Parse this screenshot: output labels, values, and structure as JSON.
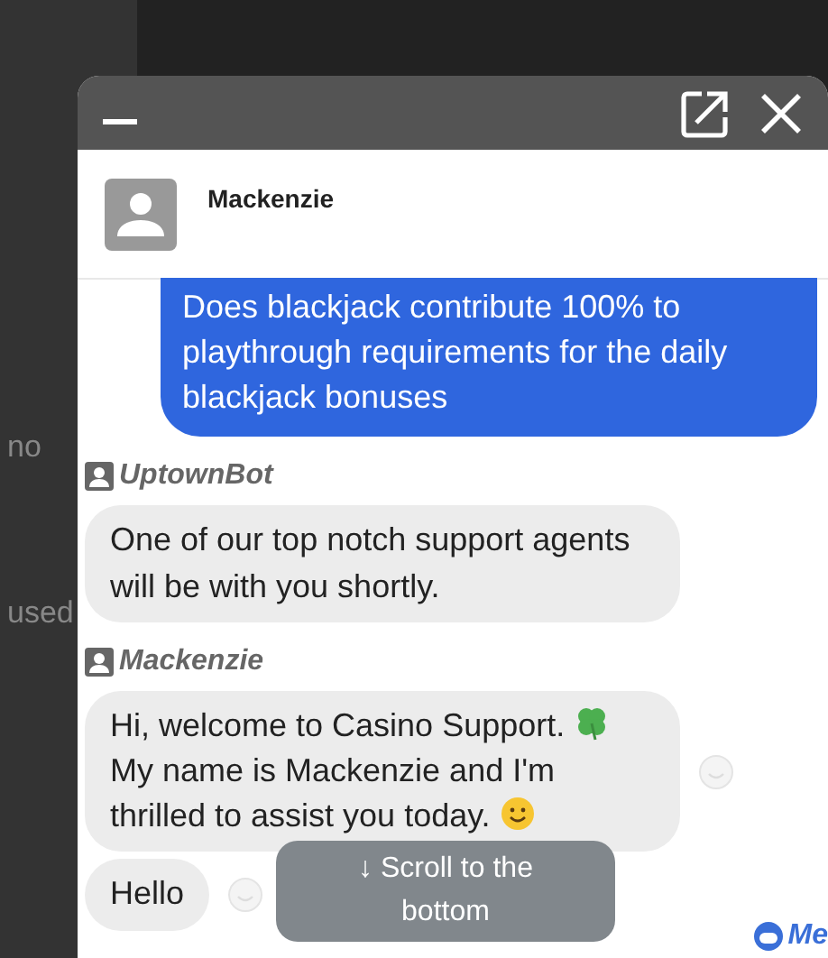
{
  "background_texts": [
    "no",
    "used"
  ],
  "chat_window": {
    "contact": {
      "name": "Mackenzie"
    },
    "messages": [
      {
        "kind": "outgoing",
        "parts": [
          {
            "kind": "text",
            "text": "Does blackjack contribute 100% to playthrough requirements for the daily blackjack bonuses"
          }
        ]
      },
      {
        "kind": "incoming",
        "sender": "UptownBot",
        "reaction": false,
        "parts": [
          {
            "kind": "text",
            "text": "One of our top notch support agents will be with you shortly."
          }
        ]
      },
      {
        "kind": "incoming",
        "sender": "Mackenzie",
        "reaction": true,
        "parts": [
          {
            "kind": "text",
            "text": "Hi, welcome to Casino Support. "
          },
          {
            "kind": "clover"
          },
          {
            "kind": "text",
            "text": " My name is Mackenzie and I'm thrilled to assist you today. "
          },
          {
            "kind": "smiley"
          }
        ]
      },
      {
        "kind": "incoming",
        "reaction": true,
        "parts": [
          {
            "kind": "text",
            "text": "Hello"
          }
        ]
      }
    ],
    "scroll_button": "↓ Scroll to the bottom",
    "brand": "Me"
  }
}
